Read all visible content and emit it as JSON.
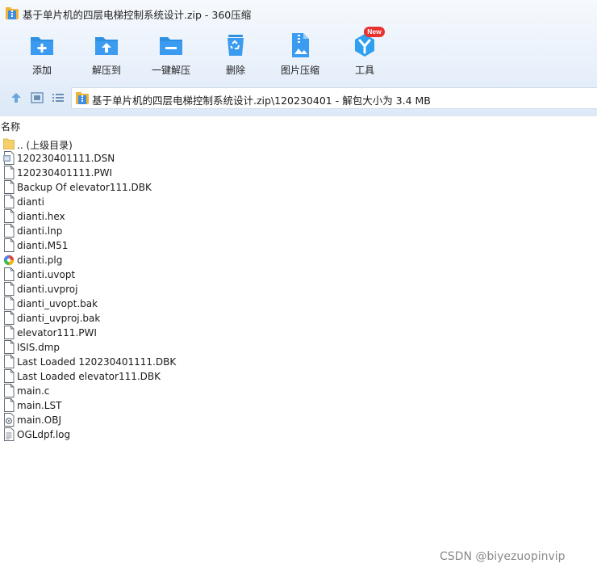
{
  "window": {
    "title": "基于单片机的四层电梯控制系统设计.zip - 360压缩"
  },
  "toolbar": {
    "items": [
      {
        "label": "添加",
        "icon": "add-icon"
      },
      {
        "label": "解压到",
        "icon": "extract-to-icon"
      },
      {
        "label": "一键解压",
        "icon": "one-click-extract-icon"
      },
      {
        "label": "删除",
        "icon": "delete-icon"
      },
      {
        "label": "图片压缩",
        "icon": "image-compress-icon"
      },
      {
        "label": "工具",
        "icon": "tools-icon",
        "badge": "New"
      }
    ],
    "accent_color": "#2f8fe0",
    "badge_color": "#e8322f"
  },
  "address": {
    "path": "基于单片机的四层电梯控制系统设计.zip\\120230401 - 解包大小为 3.4 MB"
  },
  "list": {
    "column_name": "名称",
    "files": [
      {
        "name": ".. (上级目录)",
        "type": "folder"
      },
      {
        "name": "120230401111.DSN",
        "type": "dsn"
      },
      {
        "name": "120230401111.PWI",
        "type": "doc"
      },
      {
        "name": "Backup Of elevator111.DBK",
        "type": "doc"
      },
      {
        "name": "dianti",
        "type": "doc"
      },
      {
        "name": "dianti.hex",
        "type": "doc"
      },
      {
        "name": "dianti.lnp",
        "type": "doc"
      },
      {
        "name": "dianti.M51",
        "type": "doc"
      },
      {
        "name": "dianti.plg",
        "type": "plg"
      },
      {
        "name": "dianti.uvopt",
        "type": "doc"
      },
      {
        "name": "dianti.uvproj",
        "type": "doc"
      },
      {
        "name": "dianti_uvopt.bak",
        "type": "doc"
      },
      {
        "name": "dianti_uvproj.bak",
        "type": "doc"
      },
      {
        "name": "elevator111.PWI",
        "type": "doc"
      },
      {
        "name": "ISIS.dmp",
        "type": "doc"
      },
      {
        "name": "Last Loaded 120230401111.DBK",
        "type": "doc"
      },
      {
        "name": "Last Loaded elevator111.DBK",
        "type": "doc"
      },
      {
        "name": "main.c",
        "type": "doc"
      },
      {
        "name": "main.LST",
        "type": "doc"
      },
      {
        "name": "main.OBJ",
        "type": "obj"
      },
      {
        "name": "OGLdpf.log",
        "type": "log"
      }
    ]
  },
  "watermark": "CSDN @biyezuopinvip"
}
